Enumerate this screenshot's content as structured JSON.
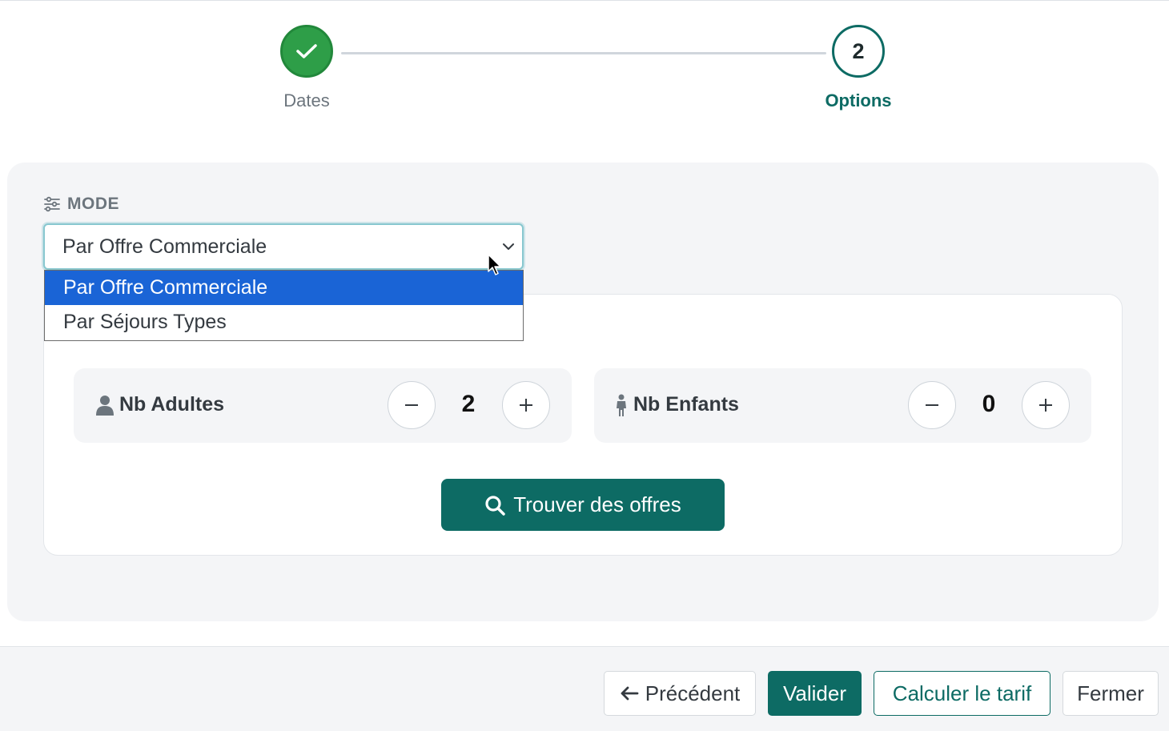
{
  "stepper": {
    "steps": [
      {
        "label": "Dates",
        "status": "completed",
        "icon": "check-icon"
      },
      {
        "label": "Options",
        "number": "2",
        "status": "active"
      }
    ]
  },
  "mode": {
    "label": "MODE",
    "icon": "sliders-icon",
    "selected": "Par Offre Commerciale",
    "options": [
      "Par Offre Commerciale",
      "Par Séjours Types"
    ]
  },
  "counters": {
    "adults": {
      "label": "Nb Adultes",
      "value": "2",
      "icon": "user-icon"
    },
    "children": {
      "label": "Nb Enfants",
      "value": "0",
      "icon": "child-icon"
    }
  },
  "search": {
    "label": "Trouver des offres",
    "icon": "search-icon"
  },
  "footer": {
    "previous_label": "Précédent",
    "validate_label": "Valider",
    "calculate_label": "Calculer le tarif",
    "close_label": "Fermer"
  },
  "colors": {
    "primary": "#0d6b64",
    "success": "#2e9e48",
    "selection": "#1a64d6"
  }
}
